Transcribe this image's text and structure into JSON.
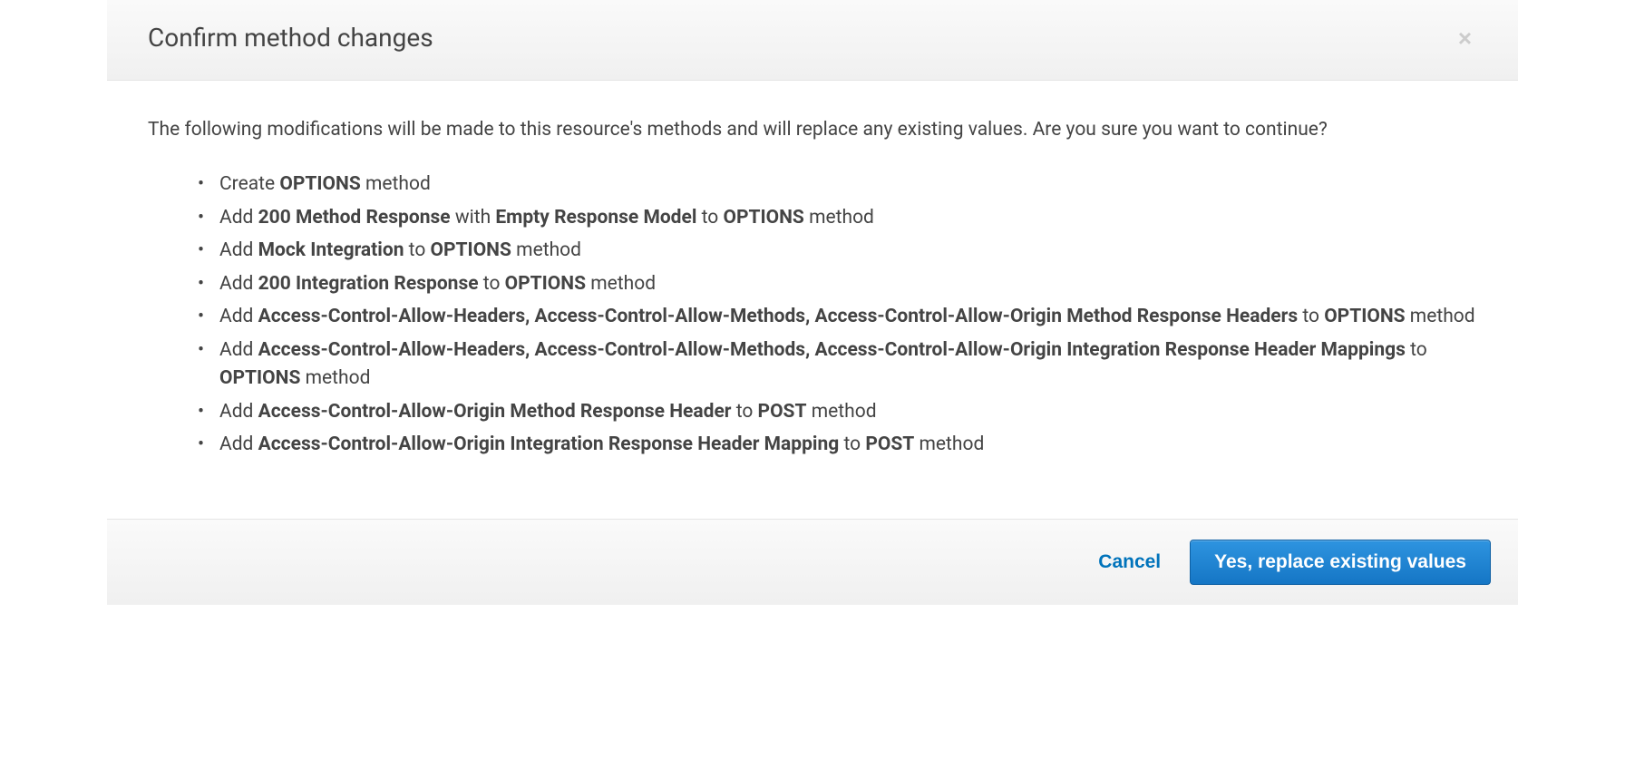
{
  "dialog": {
    "title": "Confirm method changes",
    "intro": "The following modifications will be made to this resource's methods and will replace any existing values. Are you sure you want to continue?",
    "items": [
      [
        {
          "t": "Create ",
          "b": false
        },
        {
          "t": "OPTIONS",
          "b": true
        },
        {
          "t": " method",
          "b": false
        }
      ],
      [
        {
          "t": "Add ",
          "b": false
        },
        {
          "t": "200 Method Response",
          "b": true
        },
        {
          "t": " with ",
          "b": false
        },
        {
          "t": "Empty Response Model",
          "b": true
        },
        {
          "t": " to ",
          "b": false
        },
        {
          "t": "OPTIONS",
          "b": true
        },
        {
          "t": " method",
          "b": false
        }
      ],
      [
        {
          "t": "Add ",
          "b": false
        },
        {
          "t": "Mock Integration",
          "b": true
        },
        {
          "t": " to ",
          "b": false
        },
        {
          "t": "OPTIONS",
          "b": true
        },
        {
          "t": " method",
          "b": false
        }
      ],
      [
        {
          "t": "Add ",
          "b": false
        },
        {
          "t": "200 Integration Response",
          "b": true
        },
        {
          "t": " to ",
          "b": false
        },
        {
          "t": "OPTIONS",
          "b": true
        },
        {
          "t": " method",
          "b": false
        }
      ],
      [
        {
          "t": "Add ",
          "b": false
        },
        {
          "t": "Access-Control-Allow-Headers, Access-Control-Allow-Methods, Access-Control-Allow-Origin Method Response Headers",
          "b": true
        },
        {
          "t": " to ",
          "b": false
        },
        {
          "t": "OPTIONS",
          "b": true
        },
        {
          "t": " method",
          "b": false
        }
      ],
      [
        {
          "t": "Add ",
          "b": false
        },
        {
          "t": "Access-Control-Allow-Headers, Access-Control-Allow-Methods, Access-Control-Allow-Origin Integration Response Header Mappings",
          "b": true
        },
        {
          "t": " to ",
          "b": false
        },
        {
          "t": "OPTIONS",
          "b": true
        },
        {
          "t": " method",
          "b": false
        }
      ],
      [
        {
          "t": "Add ",
          "b": false
        },
        {
          "t": "Access-Control-Allow-Origin Method Response Header",
          "b": true
        },
        {
          "t": " to ",
          "b": false
        },
        {
          "t": "POST",
          "b": true
        },
        {
          "t": " method",
          "b": false
        }
      ],
      [
        {
          "t": "Add ",
          "b": false
        },
        {
          "t": "Access-Control-Allow-Origin Integration Response Header Mapping",
          "b": true
        },
        {
          "t": " to ",
          "b": false
        },
        {
          "t": "POST",
          "b": true
        },
        {
          "t": " method",
          "b": false
        }
      ]
    ],
    "buttons": {
      "cancel": "Cancel",
      "confirm": "Yes, replace existing values"
    }
  }
}
